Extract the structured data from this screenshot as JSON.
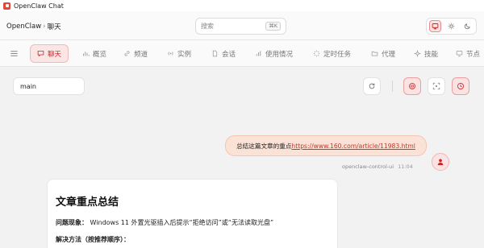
{
  "window": {
    "title": "OpenClaw Chat"
  },
  "header": {
    "breadcrumb_root": "OpenClaw",
    "breadcrumb_sep": "›",
    "breadcrumb_current": "聊天",
    "search_placeholder": "搜索",
    "search_shortcut": "⌘K"
  },
  "nav": {
    "tabs": [
      {
        "label": "聊天",
        "icon": "chat-icon",
        "active": true
      },
      {
        "label": "概览",
        "icon": "bar-chart-icon"
      },
      {
        "label": "频道",
        "icon": "link-icon"
      },
      {
        "label": "实例",
        "icon": "radio-icon"
      },
      {
        "label": "会话",
        "icon": "document-icon"
      },
      {
        "label": "使用情况",
        "icon": "stats-icon"
      },
      {
        "label": "定时任务",
        "icon": "loader-icon"
      },
      {
        "label": "代理",
        "icon": "folder-icon"
      },
      {
        "label": "技能",
        "icon": "sparkle-icon"
      },
      {
        "label": "节点",
        "icon": "monitor-icon"
      }
    ]
  },
  "toolbar": {
    "session": "main"
  },
  "chat": {
    "user_message_text": "总结这篇文章的重点",
    "user_message_link": "https://www.160.com/article/11983.html",
    "sender": "openclaw-control-ui",
    "time": "11:04",
    "assistant": {
      "title": "文章重点总结",
      "line1_label": "问题现象：",
      "line1_text": "Windows 11 外置光驱插入后提示“拒绝访问”或“无法读取光盘”",
      "line2_label": "解决方法（按推荐顺序）："
    }
  },
  "colors": {
    "accent": "#c62828",
    "bubble": "#fbe2d6"
  }
}
